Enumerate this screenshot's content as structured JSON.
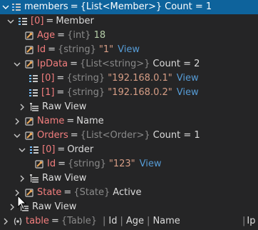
{
  "tree": {
    "members": {
      "name": "members",
      "type": "{List<Member>}",
      "value": "Count = 1"
    },
    "item0": {
      "name": "[0]",
      "value": "Member"
    },
    "age": {
      "name": "Age",
      "type": "{int}",
      "value": "18"
    },
    "id": {
      "name": "Id",
      "type": "{string}",
      "value": "\"1\"",
      "link": "View"
    },
    "ipdata": {
      "name": "IpData",
      "type": "{List<string>}",
      "value": "Count = 2"
    },
    "ip0": {
      "name": "[0]",
      "type": "{string}",
      "value": "\"192.168.0.1\"",
      "link": "View"
    },
    "ip1": {
      "name": "[1]",
      "type": "{string}",
      "value": "\"192.168.0.2\"",
      "link": "View"
    },
    "ipraw": {
      "name": "Raw View"
    },
    "namefield": {
      "name": "Name",
      "value": "Name"
    },
    "orders": {
      "name": "Orders",
      "type": "{List<Order>}",
      "value": "Count = 1"
    },
    "order0": {
      "name": "[0]",
      "value": "Order"
    },
    "orderid": {
      "name": "Id",
      "type": "{string}",
      "value": "\"123\"",
      "link": "View"
    },
    "orderraw": {
      "name": "Raw View"
    },
    "state": {
      "name": "State",
      "type": "{State}",
      "value": "Active"
    },
    "rootraw": {
      "name": "Raw View"
    },
    "table": {
      "name": "table",
      "type": "{Table}",
      "cols": [
        "Id",
        "Age",
        "Name"
      ],
      "trail": "Ip"
    }
  },
  "colors": {
    "background": "#252526",
    "selection": "#0e639c",
    "property": "#f37e7e",
    "type": "#8a8a8a",
    "string": "#d69d85",
    "number": "#b5cea8",
    "link": "#569cd6"
  },
  "icons": {
    "members": "list-icon",
    "property": "property-wrench-icon",
    "raw_view": "raw-view-icon",
    "table": "variable-icon"
  }
}
